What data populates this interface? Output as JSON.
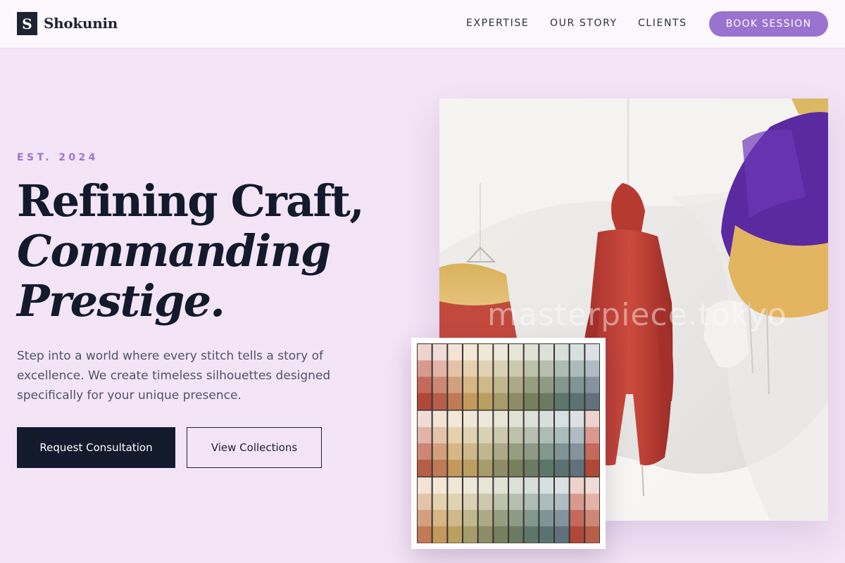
{
  "brand": {
    "mark": "S",
    "name": "Shokunin"
  },
  "nav": {
    "links": [
      "EXPERTISE",
      "OUR STORY",
      "CLIENTS"
    ],
    "cta": "BOOK SESSION"
  },
  "hero": {
    "eyebrow": "EST. 2024",
    "headline": [
      "Refining Craft,",
      "Commanding",
      "Prestige."
    ],
    "lede": "Step into a world where every stitch tells a story of excellence. We create timeless silhouettes designed specifically for your unique presence.",
    "primary_cta": "Request Consultation",
    "secondary_cta": "View Collections"
  },
  "media": {
    "photo_icon": "hanging-garments-photo",
    "watermark": "masterpiece.tokyo",
    "swatch_icon": "color-swatches-photo"
  },
  "colors": {
    "page_bg": "#f3e4f6",
    "header_bg": "#fbf7fc",
    "accent": "#9a72cf",
    "ink": "#121a2c"
  }
}
